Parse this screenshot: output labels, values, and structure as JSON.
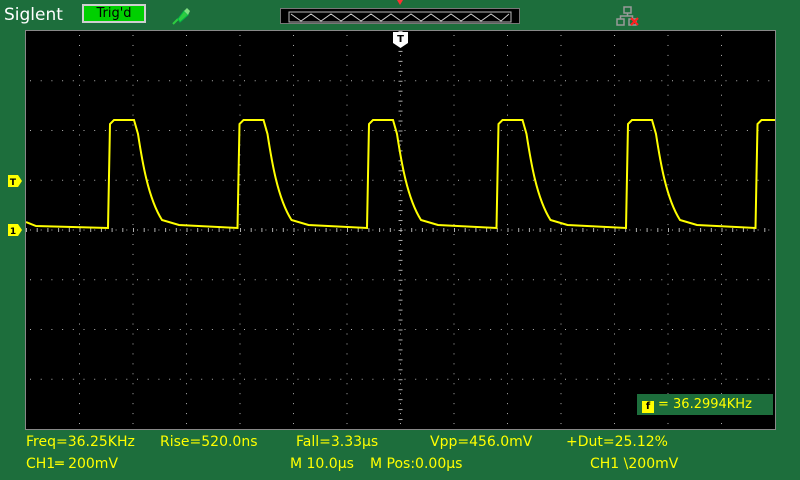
{
  "header": {
    "brand": "Siglent",
    "trigger_status": "Trig'd",
    "icons": [
      "probe-icon",
      "network-disconnected-icon"
    ]
  },
  "trace": {
    "channel": "1",
    "color": "#ffff00",
    "pulse_count_visible": 6
  },
  "markers": {
    "trigger_position": "T",
    "trigger_level": "T",
    "channel1_ground": "1"
  },
  "frequency_counter": {
    "icon": "f",
    "value": "= 36.2994KHz"
  },
  "measurements": {
    "freq": "Freq=36.25KHz",
    "rise": "Rise=520.0ns",
    "fall": "Fall=3.33µs",
    "vpp": "Vpp=456.0mV",
    "duty": "+Dut=25.12%"
  },
  "status": {
    "ch1_scale": "CH1═ 200mV",
    "timebase": "M 10.0µs",
    "position": "M Pos:0.00µs",
    "trigger": "CH1 \\200mV"
  },
  "colors": {
    "background": "#1d6e3c",
    "screen": "#000000",
    "trace": "#ffff00",
    "trig_badge": "#00d000"
  }
}
